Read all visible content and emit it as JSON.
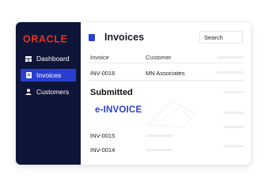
{
  "brand": {
    "logo_text": "ORACLE",
    "logo_color": "#e8331c"
  },
  "sidebar": {
    "items": [
      {
        "label": "Dashboard",
        "icon": "dashboard-icon",
        "active": false
      },
      {
        "label": "Invoices",
        "icon": "invoice-icon",
        "active": true
      },
      {
        "label": "Customers",
        "icon": "person-icon",
        "active": false
      }
    ]
  },
  "header": {
    "title": "Invoices",
    "search_label": "Search"
  },
  "table": {
    "columns": [
      "Invoice",
      "Customer"
    ],
    "rows": [
      {
        "invoice": "INV-0016",
        "customer": "MN Associates"
      },
      {
        "invoice": "INV-0015",
        "customer": ""
      },
      {
        "invoice": "INV-0014",
        "customer": ""
      }
    ]
  },
  "status_text": "Submitted",
  "einvoice_label": "e-INVOICE",
  "colors": {
    "sidebar_bg": "#0f1538",
    "accent": "#2a3fd1",
    "logo": "#e8331c"
  }
}
